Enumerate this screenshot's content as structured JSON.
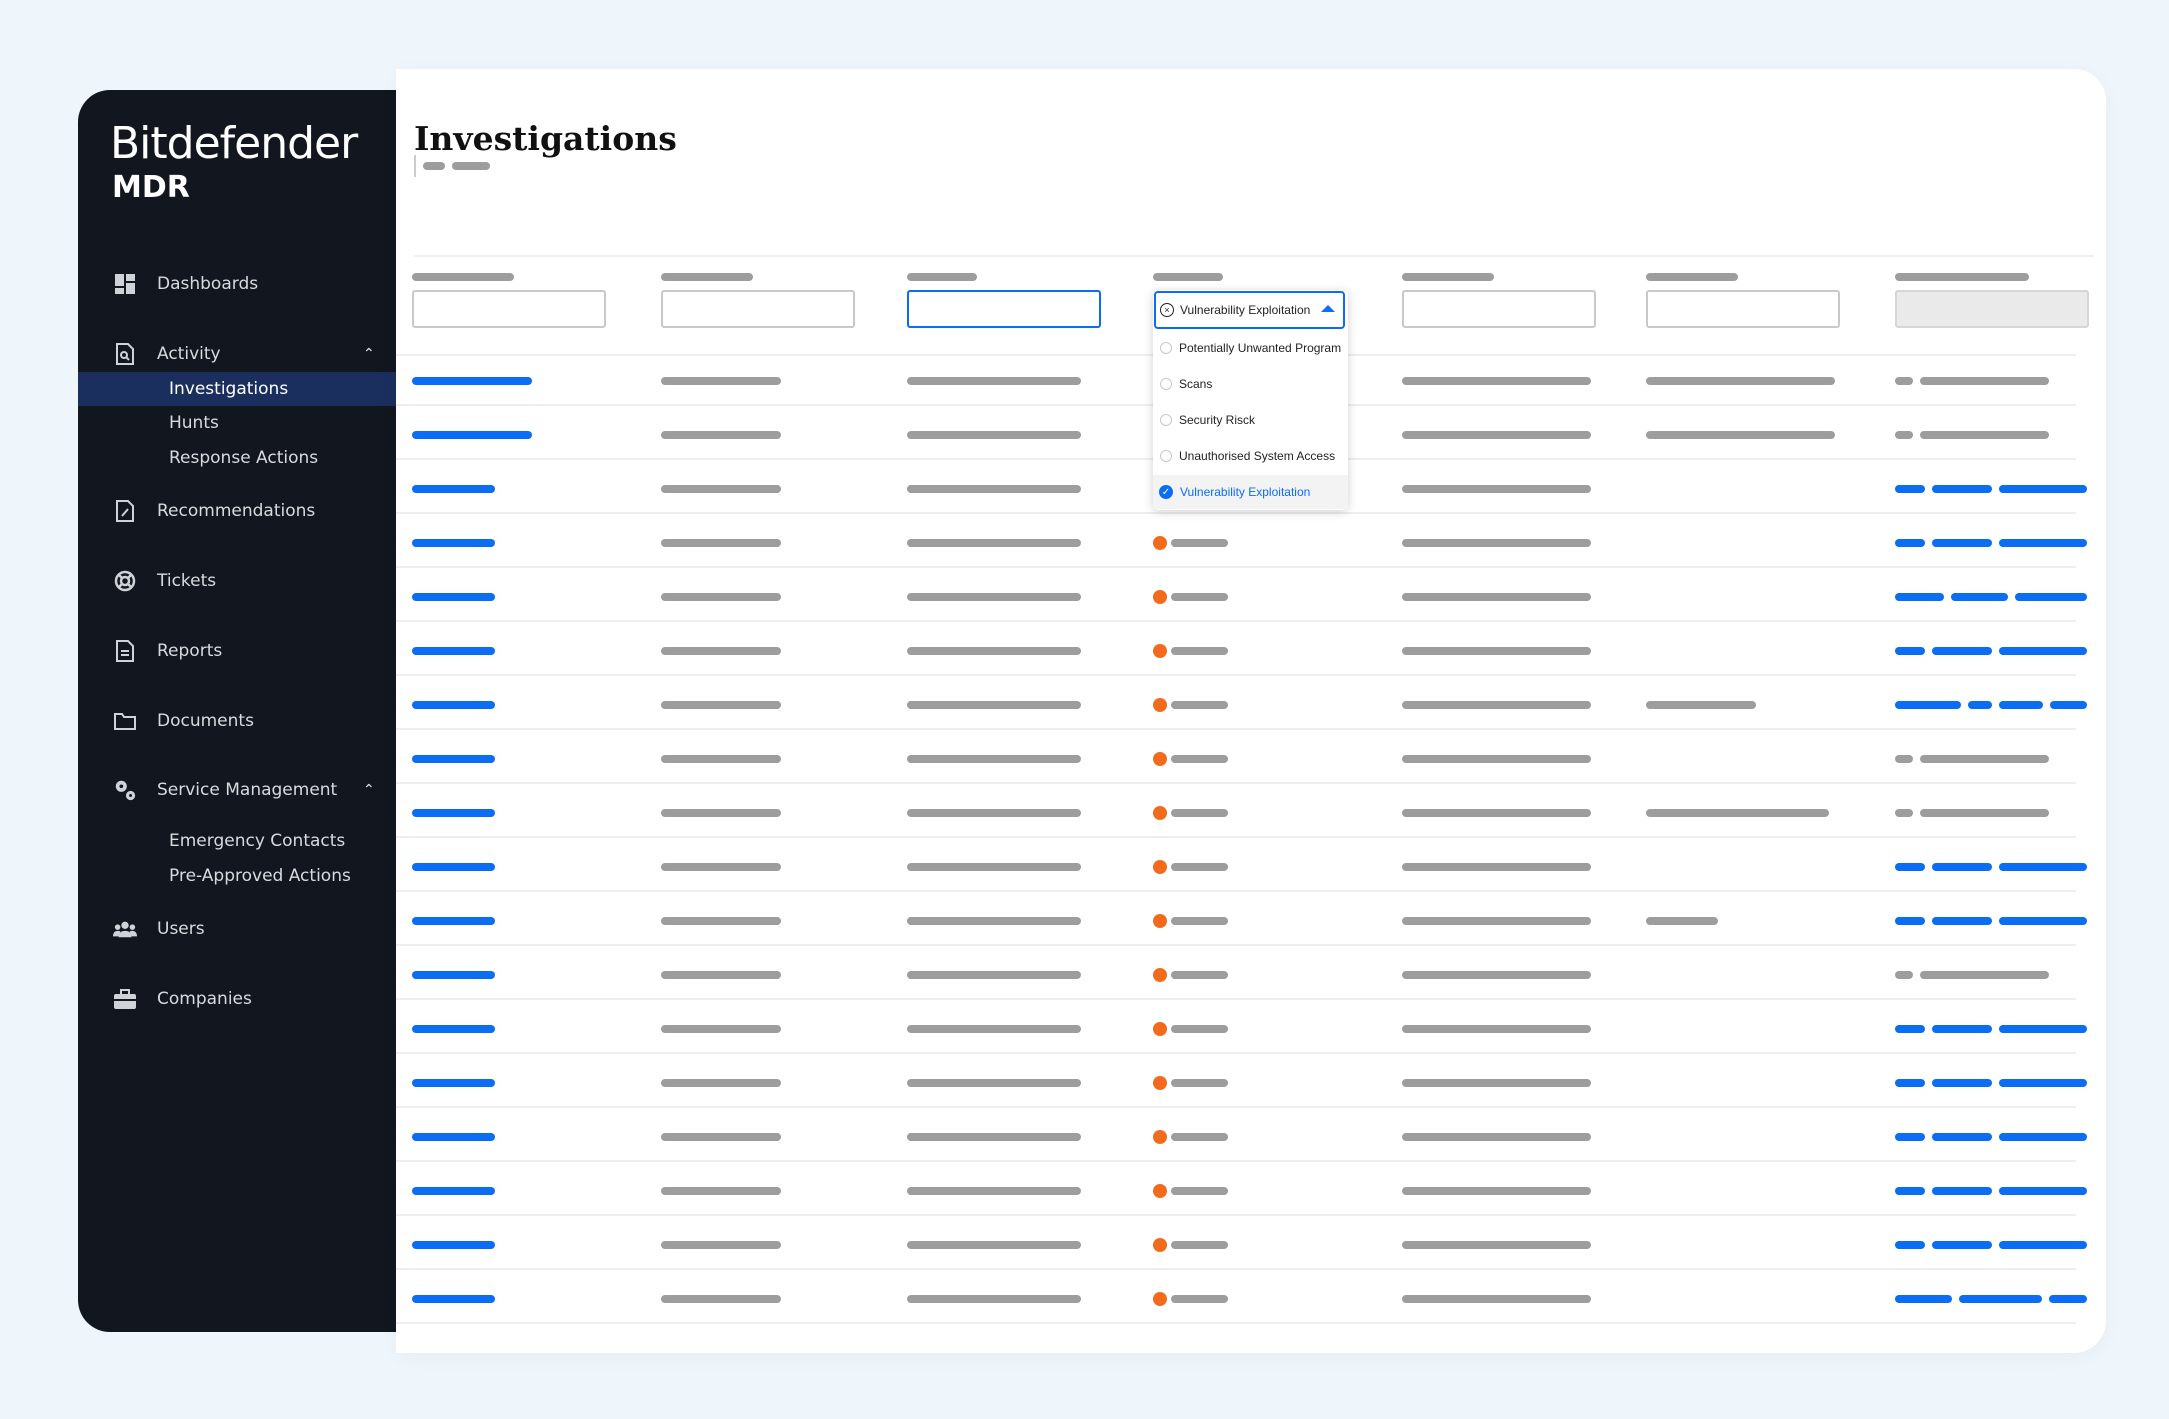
{
  "brand": {
    "name": "Bitdefender",
    "product": "MDR"
  },
  "sidebar": {
    "items": [
      {
        "label": "Dashboards",
        "icon": "dashboard-icon"
      },
      {
        "label": "Activity",
        "icon": "activity-icon",
        "expanded": true
      },
      {
        "label": "Investigations",
        "sub": true,
        "active": true
      },
      {
        "label": "Hunts",
        "sub": true
      },
      {
        "label": "Response Actions",
        "sub": true
      },
      {
        "label": "Recommendations",
        "icon": "recommendations-icon"
      },
      {
        "label": "Tickets",
        "icon": "lifebuoy-icon"
      },
      {
        "label": "Reports",
        "icon": "report-icon"
      },
      {
        "label": "Documents",
        "icon": "folder-icon"
      },
      {
        "label": "Service Management",
        "icon": "gears-icon",
        "expanded": true
      },
      {
        "label": "Emergency Contacts",
        "sub": true
      },
      {
        "label": "Pre-Approved Actions",
        "sub": true
      },
      {
        "label": "Users",
        "icon": "users-icon"
      },
      {
        "label": "Companies",
        "icon": "briefcase-icon"
      }
    ]
  },
  "page": {
    "title": "Investigations"
  },
  "filter_dropdown": {
    "selected": "Vulnerability Exploitation",
    "options": [
      {
        "label": "Potentially Unwanted Program",
        "checked": false
      },
      {
        "label": "Scans",
        "checked": false
      },
      {
        "label": "Security Risck",
        "checked": false
      },
      {
        "label": "Unauthorised System Access",
        "checked": false
      },
      {
        "label": "Vulnerability Exploitation",
        "checked": true
      }
    ]
  },
  "colors": {
    "accent": "#0b6cf4",
    "severity": "#f26b1d",
    "sidebar": "#12171f",
    "active_nav": "#1b2f5f"
  }
}
